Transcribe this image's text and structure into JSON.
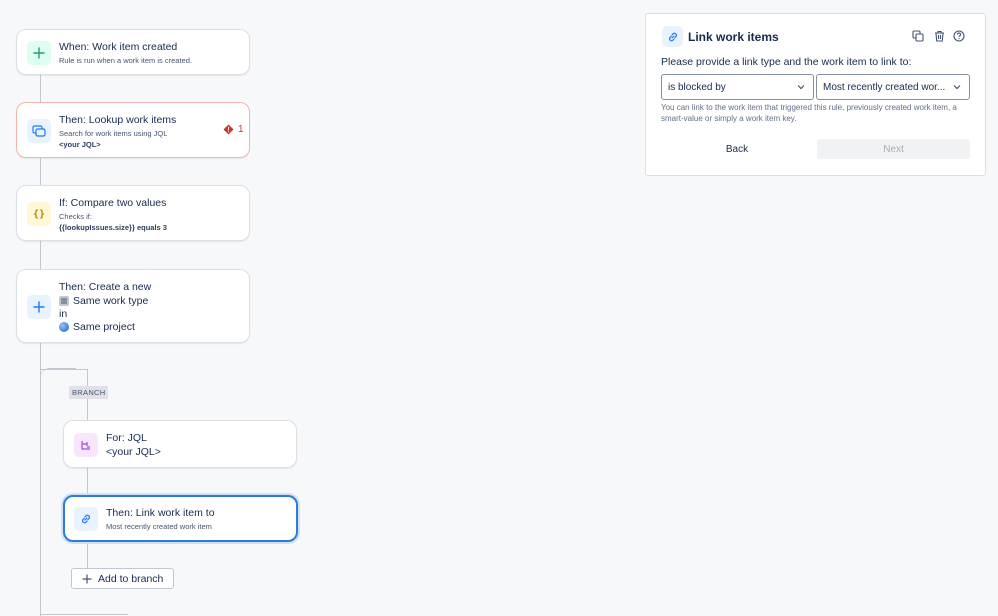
{
  "flow": {
    "trigger": {
      "title": "When: Work item created",
      "subtitle": "Rule is run when a work item is created.",
      "icon": "plus-icon",
      "color": "#22a06b"
    },
    "lookup": {
      "title": "Then: Lookup work items",
      "subtitle": "Search for work items using JQL",
      "query": "<your JQL>",
      "error_count": "1",
      "icon": "lookup-icon"
    },
    "condition": {
      "title": "If: Compare two values",
      "subtitle": "Checks if:",
      "expression": "{{lookupIssues.size}} equals 3",
      "icon": "braces-icon"
    },
    "create": {
      "title": "Then: Create a new",
      "work_type": "Same work type",
      "connector": "in",
      "project": "Same project",
      "icon": "plus-icon"
    },
    "branch_label": "BRANCH",
    "branch": {
      "title": "For: JQL",
      "query": "<your JQL>",
      "icon": "branch-icon"
    },
    "link_action": {
      "title": "Then: Link work item to",
      "subtitle": "Most recently created work item",
      "icon": "link-icon"
    },
    "add_to_branch": "Add to branch"
  },
  "panel": {
    "title": "Link work items",
    "prompt": "Please provide a link type and the work item to link to:",
    "link_type": "is blocked by",
    "target": "Most recently created wor...",
    "help": "You can link to the work item that triggered this rule, previously created work item, a smart-value or simply a work item key.",
    "back_label": "Back",
    "next_label": "Next",
    "tools": [
      "duplicate-icon",
      "delete-icon",
      "help-icon"
    ]
  },
  "colors": {
    "accent": "#2f7bd8",
    "error": "#c9372c",
    "trigger": "#22a06b",
    "condition": "#b38600"
  }
}
